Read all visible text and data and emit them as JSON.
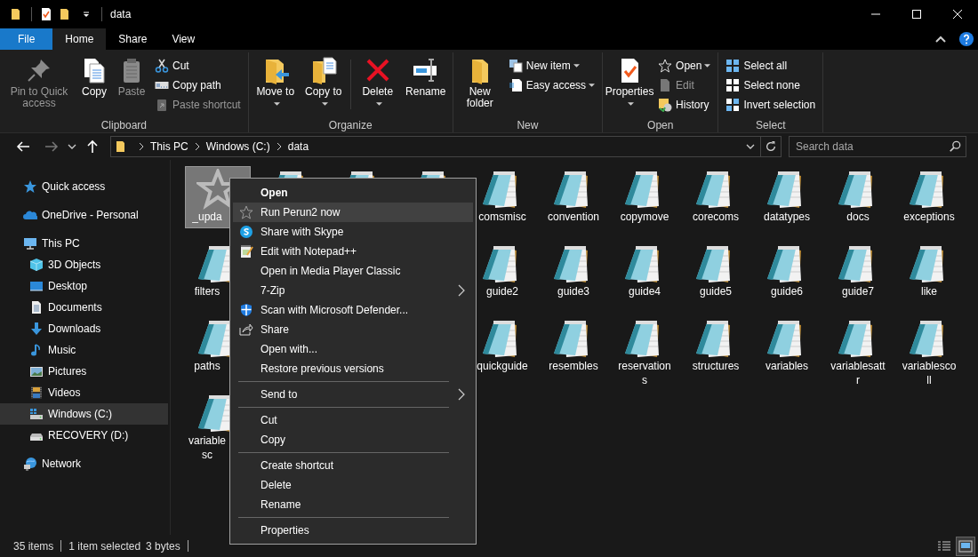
{
  "window": {
    "title": "data"
  },
  "ribbon_tabs": [
    {
      "label": "File",
      "kind": "menu",
      "selected": false
    },
    {
      "label": "Home",
      "kind": "tab",
      "selected": true
    },
    {
      "label": "Share",
      "kind": "tab",
      "selected": false
    },
    {
      "label": "View",
      "kind": "tab",
      "selected": false
    }
  ],
  "ribbon": {
    "groups": [
      {
        "label": "Clipboard",
        "large": [
          {
            "label": "Pin to Quick access",
            "disabled": true,
            "dropdown": false
          },
          {
            "label": "Copy",
            "disabled": false,
            "dropdown": false
          },
          {
            "label": "Paste",
            "disabled": true,
            "dropdown": false
          }
        ],
        "small": [
          {
            "label": "Cut",
            "disabled": false,
            "dropdown": false
          },
          {
            "label": "Copy path",
            "disabled": false,
            "dropdown": false
          },
          {
            "label": "Paste shortcut",
            "disabled": true,
            "dropdown": false
          }
        ]
      },
      {
        "label": "Organize",
        "large": [
          {
            "label": "Move to",
            "disabled": false,
            "dropdown": true
          },
          {
            "label": "Copy to",
            "disabled": false,
            "dropdown": true
          },
          {
            "label": "Delete",
            "disabled": false,
            "dropdown": true
          },
          {
            "label": "Rename",
            "disabled": false,
            "dropdown": false
          }
        ]
      },
      {
        "label": "New",
        "large": [
          {
            "label": "New folder",
            "disabled": false,
            "dropdown": false
          }
        ],
        "small": [
          {
            "label": "New item",
            "disabled": false,
            "dropdown": true
          },
          {
            "label": "Easy access",
            "disabled": false,
            "dropdown": true
          }
        ]
      },
      {
        "label": "Open",
        "large": [
          {
            "label": "Properties",
            "disabled": false,
            "dropdown": true
          }
        ],
        "small": [
          {
            "label": "Open",
            "disabled": false,
            "dropdown": true
          },
          {
            "label": "Edit",
            "disabled": true,
            "dropdown": false
          },
          {
            "label": "History",
            "disabled": false,
            "dropdown": false
          }
        ]
      },
      {
        "label": "Select",
        "small": [
          {
            "label": "Select all",
            "disabled": false,
            "dropdown": false
          },
          {
            "label": "Select none",
            "disabled": false,
            "dropdown": false
          },
          {
            "label": "Invert selection",
            "disabled": false,
            "dropdown": false
          }
        ]
      }
    ]
  },
  "navigation": {
    "back_disabled": false,
    "forward_disabled": true
  },
  "address": {
    "crumbs": [
      "This PC",
      "Windows (C:)",
      "data"
    ]
  },
  "search": {
    "placeholder": "Search data"
  },
  "nav_pane": {
    "items": [
      {
        "label": "Quick access",
        "selected": false
      },
      {
        "label": "OneDrive - Personal",
        "selected": false
      },
      {
        "label": "This PC",
        "selected": false,
        "children": [
          {
            "label": "3D Objects",
            "selected": false
          },
          {
            "label": "Desktop",
            "selected": false
          },
          {
            "label": "Documents",
            "selected": false
          },
          {
            "label": "Downloads",
            "selected": false
          },
          {
            "label": "Music",
            "selected": false
          },
          {
            "label": "Pictures",
            "selected": false
          },
          {
            "label": "Videos",
            "selected": false
          },
          {
            "label": "Windows (C:)",
            "selected": true
          },
          {
            "label": "RECOVERY (D:)",
            "selected": false
          }
        ]
      },
      {
        "label": "Network",
        "selected": false
      }
    ]
  },
  "files": [
    {
      "kind": "shortcut",
      "lines": [
        "_upda"
      ],
      "selected": true,
      "clipped": true
    },
    {
      "kind": "text",
      "selected": false
    },
    {
      "kind": "text",
      "selected": false
    },
    {
      "kind": "text",
      "selected": false
    },
    {
      "kind": "text",
      "lines": [
        "comsmisc"
      ],
      "selected": false,
      "clipped": false
    },
    {
      "kind": "text",
      "lines": [
        "convention"
      ],
      "selected": false,
      "clipped": false
    },
    {
      "kind": "text",
      "lines": [
        "copymove"
      ],
      "selected": false,
      "clipped": false
    },
    {
      "kind": "text",
      "lines": [
        "corecoms"
      ],
      "selected": false,
      "clipped": false
    },
    {
      "kind": "text",
      "lines": [
        "datatypes"
      ],
      "selected": false,
      "clipped": false
    },
    {
      "kind": "text",
      "lines": [
        "docs"
      ],
      "selected": false,
      "clipped": false
    },
    {
      "kind": "text",
      "lines": [
        "exceptions"
      ],
      "selected": false,
      "clipped": false
    },
    {
      "kind": "text",
      "lines": [
        "filters"
      ],
      "selected": false,
      "clipped": true
    },
    {
      "kind": "covered"
    },
    {
      "kind": "covered"
    },
    {
      "kind": "covered"
    },
    {
      "kind": "text",
      "lines": [
        "guide2"
      ],
      "selected": false,
      "clipped": false
    },
    {
      "kind": "text",
      "lines": [
        "guide3"
      ],
      "selected": false,
      "clipped": false
    },
    {
      "kind": "text",
      "lines": [
        "guide4"
      ],
      "selected": false,
      "clipped": false
    },
    {
      "kind": "text",
      "lines": [
        "guide5"
      ],
      "selected": false,
      "clipped": false
    },
    {
      "kind": "text",
      "lines": [
        "guide6"
      ],
      "selected": false,
      "clipped": false
    },
    {
      "kind": "text",
      "lines": [
        "guide7"
      ],
      "selected": false,
      "clipped": false
    },
    {
      "kind": "text",
      "lines": [
        "like"
      ],
      "selected": false,
      "clipped": false
    },
    {
      "kind": "text",
      "lines": [
        "paths"
      ],
      "selected": false,
      "clipped": true
    },
    {
      "kind": "covered"
    },
    {
      "kind": "covered"
    },
    {
      "kind": "covered"
    },
    {
      "kind": "text",
      "lines": [
        "quickguide"
      ],
      "selected": false,
      "clipped": false
    },
    {
      "kind": "text",
      "lines": [
        "resembles"
      ],
      "selected": false,
      "clipped": false
    },
    {
      "kind": "text",
      "lines": [
        "reservation",
        "s"
      ],
      "selected": false,
      "clipped": false
    },
    {
      "kind": "text",
      "lines": [
        "structures"
      ],
      "selected": false,
      "clipped": false
    },
    {
      "kind": "text",
      "lines": [
        "variables"
      ],
      "selected": false,
      "clipped": false
    },
    {
      "kind": "text",
      "lines": [
        "variablesatt",
        "r"
      ],
      "selected": false,
      "clipped": false
    },
    {
      "kind": "text",
      "lines": [
        "variablesco",
        "ll"
      ],
      "selected": false,
      "clipped": false
    },
    {
      "kind": "text",
      "lines": [
        "variable",
        "sc"
      ],
      "selected": false,
      "clipped": true
    }
  ],
  "context_menu": [
    {
      "kind": "item",
      "label": "Open",
      "default": true,
      "selected": false,
      "submenu": false
    },
    {
      "kind": "item",
      "label": "Run Perun2 now",
      "default": false,
      "selected": true,
      "submenu": false
    },
    {
      "kind": "item",
      "label": "Share with Skype",
      "default": false,
      "selected": false,
      "submenu": false
    },
    {
      "kind": "item",
      "label": "Edit with Notepad++",
      "default": false,
      "selected": false,
      "submenu": false
    },
    {
      "kind": "item",
      "label": "Open in Media Player Classic",
      "default": false,
      "selected": false,
      "submenu": false
    },
    {
      "kind": "item",
      "label": "7-Zip",
      "default": false,
      "selected": false,
      "submenu": true
    },
    {
      "kind": "item",
      "label": "Scan with Microsoft Defender...",
      "default": false,
      "selected": false,
      "submenu": false
    },
    {
      "kind": "item",
      "label": "Share",
      "default": false,
      "selected": false,
      "submenu": false
    },
    {
      "kind": "item",
      "label": "Open with...",
      "default": false,
      "selected": false,
      "submenu": false
    },
    {
      "kind": "item",
      "label": "Restore previous versions",
      "default": false,
      "selected": false,
      "submenu": false
    },
    {
      "kind": "separator"
    },
    {
      "kind": "item",
      "label": "Send to",
      "default": false,
      "selected": false,
      "submenu": true
    },
    {
      "kind": "separator"
    },
    {
      "kind": "item",
      "label": "Cut",
      "default": false,
      "selected": false,
      "submenu": false
    },
    {
      "kind": "item",
      "label": "Copy",
      "default": false,
      "selected": false,
      "submenu": false
    },
    {
      "kind": "separator"
    },
    {
      "kind": "item",
      "label": "Create shortcut",
      "default": false,
      "selected": false,
      "submenu": false
    },
    {
      "kind": "item",
      "label": "Delete",
      "default": false,
      "selected": false,
      "submenu": false
    },
    {
      "kind": "item",
      "label": "Rename",
      "default": false,
      "selected": false,
      "submenu": false
    },
    {
      "kind": "separator"
    },
    {
      "kind": "item",
      "label": "Properties",
      "default": false,
      "selected": false,
      "submenu": false
    }
  ],
  "status_bar": {
    "item_count": "35 items",
    "selection": "1 item selected",
    "size": "3 bytes",
    "views": [
      {
        "selected": false
      },
      {
        "selected": true
      }
    ]
  }
}
